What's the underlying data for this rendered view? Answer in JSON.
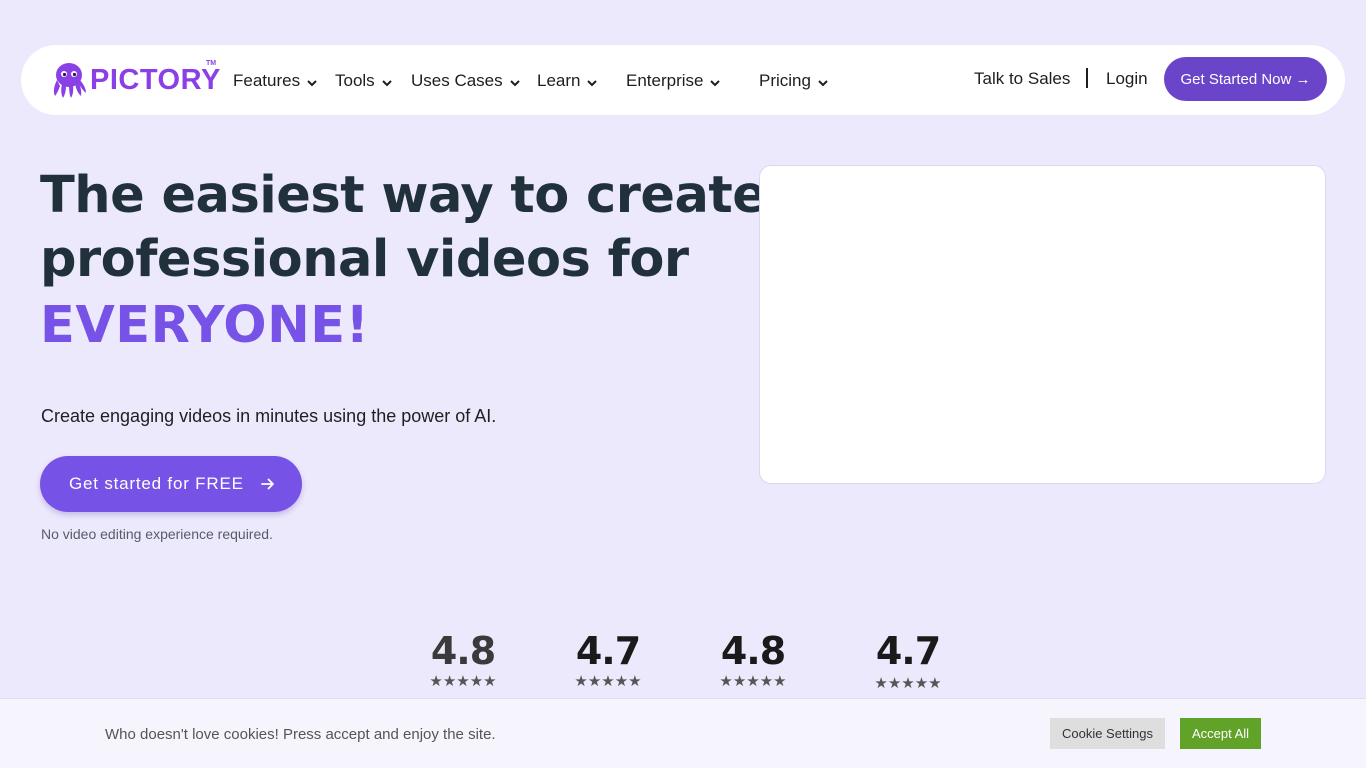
{
  "nav": {
    "logo_text": "PICTORY",
    "logo_tm": "TM",
    "items": [
      {
        "label": "Features"
      },
      {
        "label": "Tools"
      },
      {
        "label": "Uses Cases"
      },
      {
        "label": "Learn"
      },
      {
        "label": "Enterprise"
      },
      {
        "label": "Pricing"
      }
    ],
    "talk_to_sales": "Talk to Sales",
    "login": "Login",
    "cta": "Get Started Now →"
  },
  "hero": {
    "title_line1": "The easiest way to create",
    "title_line2": "professional videos for",
    "title_accent": "EVERYONE!",
    "subtitle": "Create engaging videos in minutes using the power of AI.",
    "cta": "Get started for FREE",
    "note": "No video editing experience required."
  },
  "ratings": [
    {
      "score": "4.8",
      "stars": "★★★★★",
      "color": "#3a3a3a"
    },
    {
      "score": "4.7",
      "stars": "★★★★★",
      "color": "#1a1a1a"
    },
    {
      "score": "4.8",
      "stars": "★★★★★",
      "color": "#1a1a1a"
    },
    {
      "score": "4.7",
      "stars": "★★★★★",
      "color": "#1a1a1a"
    }
  ],
  "cookie": {
    "text": "Who doesn't love cookies! Press accept and enjoy the site.",
    "settings": "Cookie Settings",
    "accept": "Accept All"
  },
  "colors": {
    "accent": "#7752e6",
    "nav_cta": "#6a45c9",
    "logo": "#8b3fe6",
    "accept": "#61a229",
    "background": "#ede9fd"
  }
}
